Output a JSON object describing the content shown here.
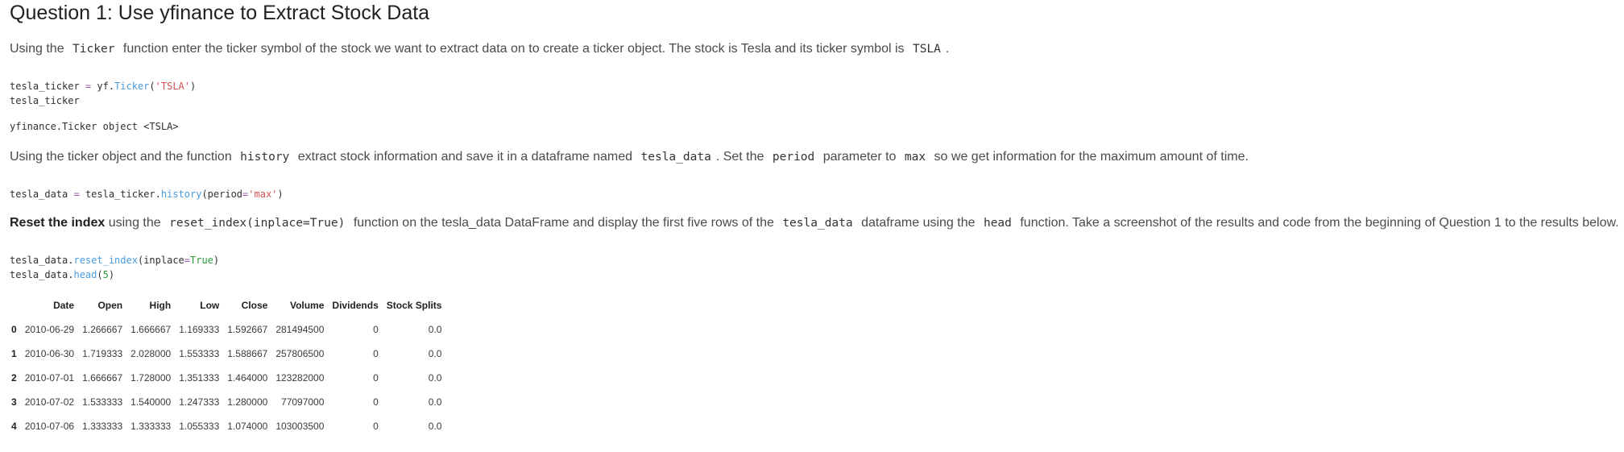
{
  "title": "Question 1: Use yfinance to Extract Stock Data",
  "para1": {
    "t1": "Using the",
    "c1": "Ticker",
    "t2": "function enter the ticker symbol of the stock we want to extract data on to create a ticker object. The stock is Tesla and its ticker symbol is",
    "c2": "TSLA",
    "t3": "."
  },
  "code1": {
    "l1_a": "tesla_ticker ",
    "l1_op": "=",
    "l1_b": " yf.",
    "l1_fn": "Ticker",
    "l1_c": "(",
    "l1_str": "'TSLA'",
    "l1_d": ")",
    "l2": "tesla_ticker"
  },
  "output1": "yfinance.Ticker object <TSLA>",
  "para2": {
    "t1": "Using the ticker object and the function",
    "c1": "history",
    "t2": "extract stock information and save it in a dataframe named",
    "c2": "tesla_data",
    "t3": ". Set the",
    "c3": "period",
    "t4": "parameter to",
    "c4": "max",
    "t5": "so we get information for the maximum amount of time."
  },
  "code2": {
    "a": "tesla_data ",
    "op": "=",
    "b": " tesla_ticker.",
    "fn": "history",
    "c": "(period",
    "op2": "=",
    "str": "'max'",
    "d": ")"
  },
  "para3": {
    "bold": "Reset the index",
    "t1": "using the",
    "c1": "reset_index(inplace=True)",
    "t2": "function on the tesla_data DataFrame and display the first five rows of the",
    "c2": "tesla_data",
    "t3": "dataframe using the",
    "c3": "head",
    "t4": "function. Take a screenshot of the results and code from the beginning of Question 1 to the results below."
  },
  "code3": {
    "l1_a": "tesla_data.",
    "l1_fn": "reset_index",
    "l1_b": "(inplace",
    "l1_op": "=",
    "l1_kw": "True",
    "l1_c": ")",
    "l2_a": "tesla_data.",
    "l2_fn": "head",
    "l2_b": "(",
    "l2_num": "5",
    "l2_c": ")"
  },
  "table": {
    "columns": [
      "",
      "Date",
      "Open",
      "High",
      "Low",
      "Close",
      "Volume",
      "Dividends",
      "Stock Splits"
    ],
    "rows": [
      [
        "0",
        "2010-06-29",
        "1.266667",
        "1.666667",
        "1.169333",
        "1.592667",
        "281494500",
        "0",
        "0.0"
      ],
      [
        "1",
        "2010-06-30",
        "1.719333",
        "2.028000",
        "1.553333",
        "1.588667",
        "257806500",
        "0",
        "0.0"
      ],
      [
        "2",
        "2010-07-01",
        "1.666667",
        "1.728000",
        "1.351333",
        "1.464000",
        "123282000",
        "0",
        "0.0"
      ],
      [
        "3",
        "2010-07-02",
        "1.533333",
        "1.540000",
        "1.247333",
        "1.280000",
        "77097000",
        "0",
        "0.0"
      ],
      [
        "4",
        "2010-07-06",
        "1.333333",
        "1.333333",
        "1.055333",
        "1.074000",
        "103003500",
        "0",
        "0.0"
      ]
    ]
  },
  "colors": {
    "function": "#4a9bdf",
    "string": "#d0504f",
    "keyword": "#2a9a3a",
    "operator": "#9c59b6"
  }
}
